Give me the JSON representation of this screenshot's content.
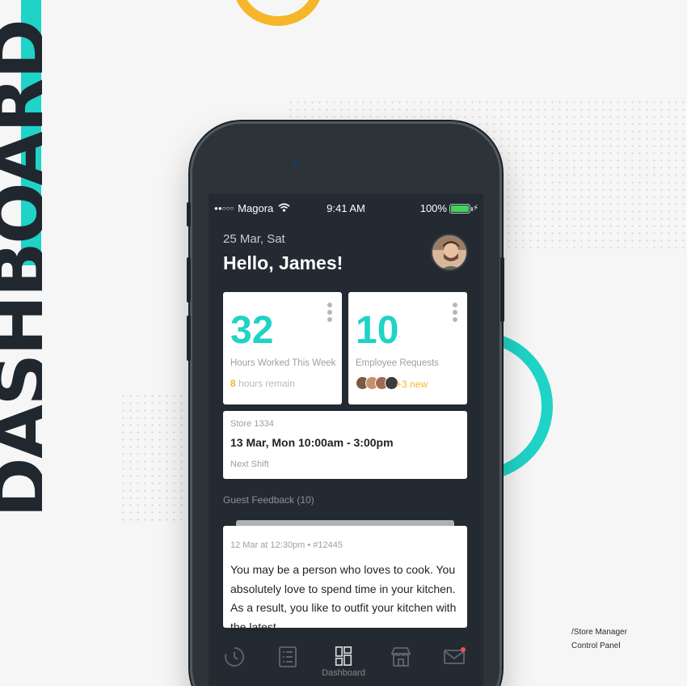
{
  "background": {
    "vertical_title": "DASHBOARD",
    "caption_line1": "/Store Manager",
    "caption_line2": "Control Panel",
    "accent_teal": "#1fd3c6",
    "accent_yellow": "#f5b629"
  },
  "status_bar": {
    "signal": "●●○○○",
    "carrier": "Magora",
    "time": "9:41 AM",
    "battery": "100%"
  },
  "header": {
    "date": "25 Mar, Sat",
    "greeting": "Hello, James!"
  },
  "cards": {
    "hours": {
      "value": "32",
      "label": "Hours Worked This Week",
      "remain_count": "8",
      "remain_text": " hours remain"
    },
    "requests": {
      "value": "10",
      "label": "Employee Requests",
      "new_text": "+3 new"
    },
    "shift": {
      "store": "Store 1334",
      "time": "13 Mar, Mon 10:00am - 3:00pm",
      "label": "Next Shift"
    }
  },
  "feedback": {
    "section_title": "Guest Feedback (10)",
    "meta": "12 Mar at 12:30pm  •  #12445",
    "text": "You may be a person who loves to cook. You absolutely love to spend time in your kitchen. As a result, you like to outfit your kitchen with the latest"
  },
  "tabs": [
    {
      "icon": "clock-icon",
      "label": ""
    },
    {
      "icon": "list-icon",
      "label": ""
    },
    {
      "icon": "dashboard-icon",
      "label": "Dashboard"
    },
    {
      "icon": "store-icon",
      "label": ""
    },
    {
      "icon": "mail-icon",
      "label": ""
    }
  ]
}
